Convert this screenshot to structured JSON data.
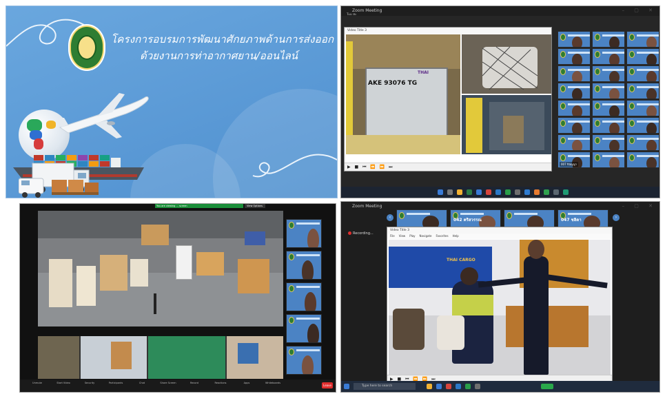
{
  "panel1": {
    "title_line1": "โครงการอบรมการพัฒนาศักยภาพด้านการส่งออก",
    "title_line2": "ด้วยงานการท่าอากาศยาน/ออนไลน์"
  },
  "panel2": {
    "window_title": "Zoom Meeting",
    "window_sub": "Tuu ละ",
    "player_title": "Video Title 3",
    "unit_label": "AKE 93076 TG",
    "thai_logo": "THAI",
    "controls": "▶ ■ ⏮ ⏪ ⏩ ⏭",
    "tile_names": [
      "",
      "",
      "",
      "",
      "",
      "",
      "",
      "",
      "",
      "",
      "",
      "",
      "",
      "",
      "",
      "",
      "",
      "",
      "",
      "",
      "",
      "007 จินัญญา",
      "",
      ""
    ]
  },
  "panel3": {
    "green_bar": "You are viewing ... screen",
    "update_button": "View Options",
    "tile_names": [
      "",
      "",
      "",
      "",
      ""
    ],
    "toolbar_items": [
      "Unmute",
      "Start Video",
      "Security",
      "Participants",
      "Chat",
      "Share Screen",
      "Record",
      "Reactions",
      "Apps",
      "Whiteboards"
    ],
    "leave_label": "Leave"
  },
  "panel4": {
    "window_title": "Zoom Meeting",
    "recording_label": "Recording...",
    "player_title": "Video Title 3",
    "menu": [
      "File",
      "View",
      "Play",
      "Navigate",
      "Favorites",
      "Help"
    ],
    "strip_labels": [
      "",
      "042 คริสวรรณ",
      "",
      "047 ชลิดา"
    ],
    "prev_arrow": "‹",
    "next_arrow": "›",
    "thai_cargo": "THAI CARGO",
    "controls": "▶ ■ ⏮ ⏪ ⏩ ⏭",
    "search_placeholder": "Type here to search"
  },
  "colors": {
    "slide_blue": "#5b9bd5",
    "zoom_dark": "#1e1e1e",
    "tile_blue": "#4b83c4",
    "leave_red": "#e02e2e"
  }
}
